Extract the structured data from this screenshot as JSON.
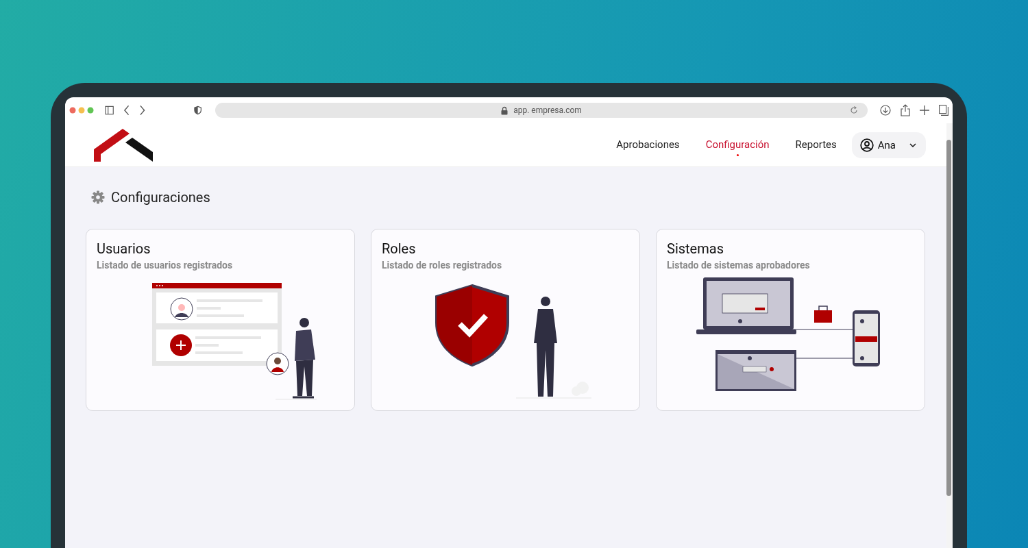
{
  "browser": {
    "url": "app. empresa.com"
  },
  "nav": {
    "items": [
      {
        "label": "Aprobaciones",
        "selected": false
      },
      {
        "label": "Configuración",
        "selected": true
      },
      {
        "label": "Reportes",
        "selected": false
      }
    ],
    "user": {
      "name": "Ana"
    }
  },
  "page": {
    "title": "Configuraciones"
  },
  "cards": [
    {
      "kind": "users",
      "title": "Usuarios",
      "subtitle": "Listado de usuarios registrados"
    },
    {
      "kind": "roles",
      "title": "Roles",
      "subtitle": "Listado de roles registrados"
    },
    {
      "kind": "systems",
      "title": "Sistemas",
      "subtitle": "Listado de sistemas aprobadores"
    }
  ]
}
